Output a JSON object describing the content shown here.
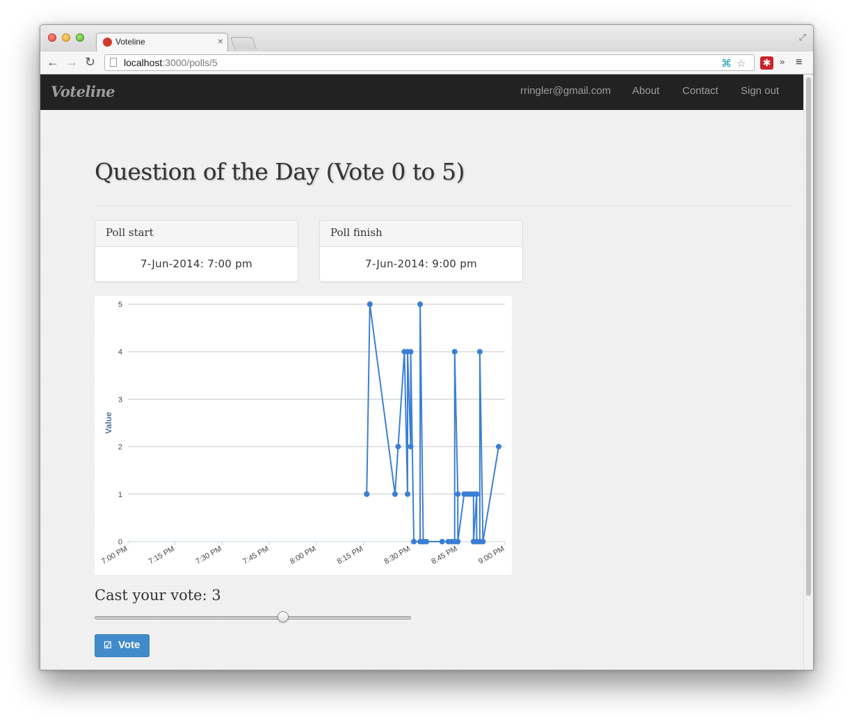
{
  "browser": {
    "tab_title": "Voteline",
    "tab_close": "×",
    "url_host": "localhost",
    "url_path": ":3000/polls/5"
  },
  "navbar": {
    "brand": "Voteline",
    "links": [
      "rringler@gmail.com",
      "About",
      "Contact",
      "Sign out"
    ]
  },
  "page": {
    "title": "Question of the Day (Vote 0 to 5)",
    "poll_start": {
      "label": "Poll start",
      "value": "7-Jun-2014: 7:00 pm"
    },
    "poll_finish": {
      "label": "Poll finish",
      "value": "7-Jun-2014: 9:00 pm"
    },
    "vote_label": "Cast your vote: 3",
    "vote_value": 3,
    "vote_min": 0,
    "vote_max": 5,
    "vote_button": "Vote"
  },
  "colors": {
    "series": "#3b7fd4",
    "navbar": "#222222",
    "button": "#428bca"
  },
  "chart_data": {
    "type": "line",
    "ylabel": "Value",
    "xlabel": "",
    "ylim": [
      0,
      5
    ],
    "y_ticks": [
      "0",
      "1",
      "2",
      "3",
      "4",
      "5"
    ],
    "x_ticks": [
      "7:00 PM",
      "7:15 PM",
      "7:30 PM",
      "7:45 PM",
      "8:00 PM",
      "8:15 PM",
      "8:30 PM",
      "8:45 PM",
      "9:00 PM"
    ],
    "grid": true,
    "series": [
      {
        "x": [
          "8:16 PM",
          "8:16 PM",
          "8:17 PM",
          "8:17 PM",
          "8:25 PM",
          "8:26 PM",
          "8:28 PM",
          "8:29 PM",
          "8:29 PM",
          "8:30 PM",
          "8:30 PM",
          "8:31 PM",
          "8:33 PM",
          "8:33 PM",
          "8:34 PM",
          "8:34 PM",
          "8:35 PM",
          "8:40 PM",
          "8:42 PM",
          "8:43 PM",
          "8:44 PM",
          "8:44 PM",
          "8:45 PM",
          "8:45 PM",
          "8:47 PM",
          "8:48 PM",
          "8:49 PM",
          "8:50 PM",
          "8:50 PM",
          "8:51 PM",
          "8:51 PM",
          "8:52 PM",
          "8:52 PM",
          "8:53 PM",
          "8:58 PM"
        ],
        "values": [
          1,
          1,
          5,
          5,
          1,
          2,
          4,
          1,
          4,
          2,
          4,
          0,
          0,
          5,
          0,
          0,
          0,
          0,
          0,
          0,
          0,
          4,
          1,
          0,
          1,
          1,
          1,
          1,
          0,
          1,
          0,
          0,
          4,
          0,
          2
        ]
      }
    ]
  }
}
